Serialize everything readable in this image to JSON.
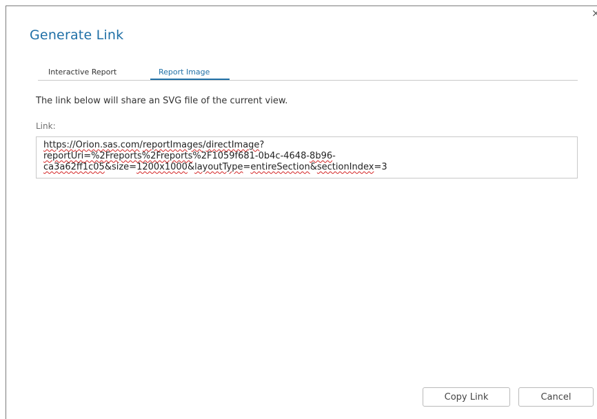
{
  "dialog": {
    "title": "Generate Link",
    "close_glyph": "×"
  },
  "tabs": [
    {
      "label": "Interactive Report",
      "selected": false
    },
    {
      "label": "Report Image",
      "selected": true
    }
  ],
  "description": "The link below will share an SVG file of the current view.",
  "link": {
    "label": "Link:",
    "line1": [
      "https://",
      "Orion.sas.com",
      "/",
      "reportImages",
      "/",
      "directImage",
      "?"
    ],
    "line2": [
      "reportUri",
      "=%2Freports",
      "%2Freports",
      "%2F1059f681-0b4c-4648-",
      "8b96",
      "-"
    ],
    "line3": [
      "ca3a62ff1c05",
      "&size=",
      "1200x1000",
      "&",
      "layoutType",
      "=",
      "entireSection",
      "&",
      "sectionIndex",
      "=3"
    ]
  },
  "buttons": {
    "copy": "Copy Link",
    "cancel": "Cancel"
  },
  "colors": {
    "accent": "#1f6fa6",
    "spell_error": "#d32020"
  }
}
